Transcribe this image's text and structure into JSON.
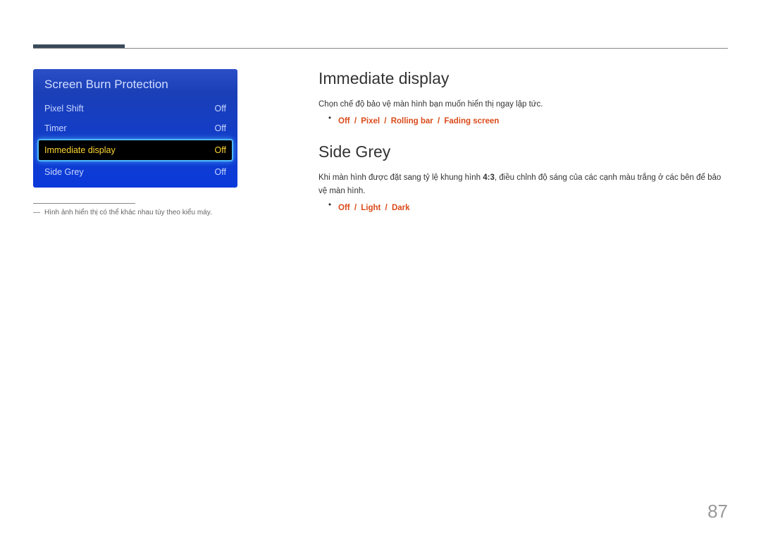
{
  "menu": {
    "title": "Screen Burn Protection",
    "items": [
      {
        "label": "Pixel Shift",
        "value": "Off",
        "selected": false
      },
      {
        "label": "Timer",
        "value": "Off",
        "selected": false
      },
      {
        "label": "Immediate display",
        "value": "Off",
        "selected": true
      },
      {
        "label": "Side Grey",
        "value": "Off",
        "selected": false
      }
    ]
  },
  "footnote": {
    "dash": "―",
    "text": "Hình ảnh hiển thị có thể khác nhau tùy theo kiểu máy."
  },
  "sections": {
    "immediate": {
      "heading": "Immediate display",
      "body": "Chọn chế độ bảo vệ màn hình bạn muốn hiển thị ngay lập tức.",
      "options": [
        "Off",
        "Pixel",
        "Rolling bar",
        "Fading screen"
      ]
    },
    "sidegrey": {
      "heading": "Side Grey",
      "body_before": "Khi màn hình được đặt sang tỷ lệ khung hình ",
      "ratio": "4:3",
      "body_after": ", điều chỉnh độ sáng của các cạnh màu trắng ở các bên để bảo vệ màn hình.",
      "options": [
        "Off",
        "Light",
        "Dark"
      ]
    }
  },
  "page_number": "87"
}
